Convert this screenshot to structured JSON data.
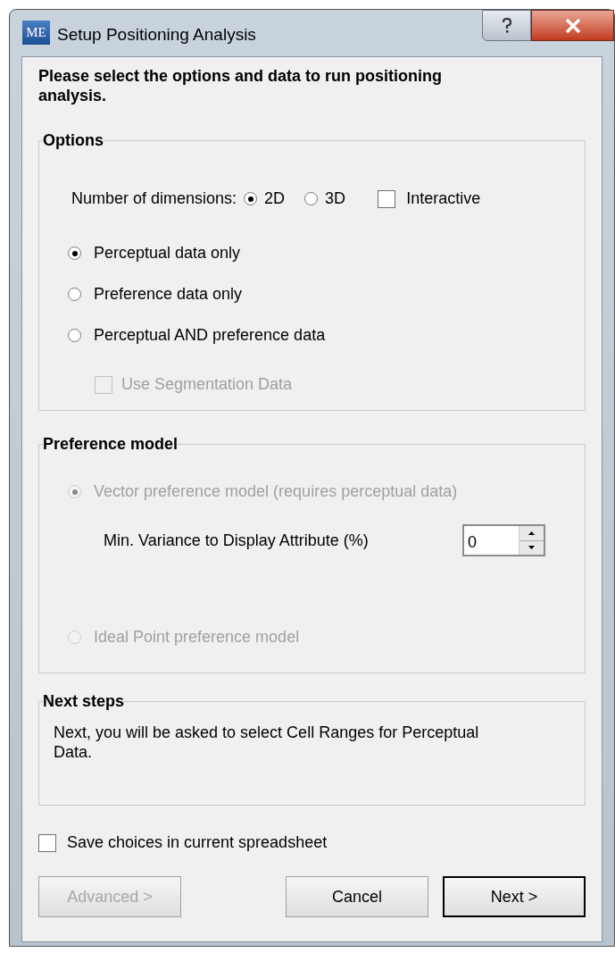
{
  "window": {
    "logo": "ME",
    "title": "Setup Positioning Analysis"
  },
  "heading": "Please select the options and data to run positioning analysis.",
  "options": {
    "title": "Options",
    "dimensions": {
      "label": "Number of dimensions:",
      "choices": [
        {
          "label": "2D",
          "selected": true
        },
        {
          "label": "3D",
          "selected": false
        }
      ]
    },
    "interactive": {
      "label": "Interactive",
      "checked": false
    },
    "data_choices": [
      {
        "label": "Perceptual data only",
        "selected": true
      },
      {
        "label": "Preference data only",
        "selected": false
      },
      {
        "label": "Perceptual AND preference data",
        "selected": false
      }
    ],
    "segmentation": {
      "label": "Use Segmentation Data",
      "checked": false,
      "disabled": true
    }
  },
  "preference_model": {
    "title": "Preference model",
    "choices": [
      {
        "label": "Vector preference model (requires perceptual data)",
        "selected": true,
        "disabled": true
      },
      {
        "label": "Ideal Point preference model",
        "selected": false,
        "disabled": true
      }
    ],
    "min_variance": {
      "label": "Min. Variance to Display Attribute (%)",
      "value": "0"
    }
  },
  "next_steps": {
    "title": "Next steps",
    "text": "Next, you will be asked to select Cell Ranges for Perceptual Data."
  },
  "save_choices": {
    "label": "Save choices in current spreadsheet",
    "checked": false
  },
  "buttons": [
    {
      "label": "Advanced >",
      "disabled": true,
      "default": false
    },
    {
      "label": "Cancel",
      "disabled": false,
      "default": false
    },
    {
      "label": "Next >",
      "disabled": false,
      "default": true
    }
  ]
}
